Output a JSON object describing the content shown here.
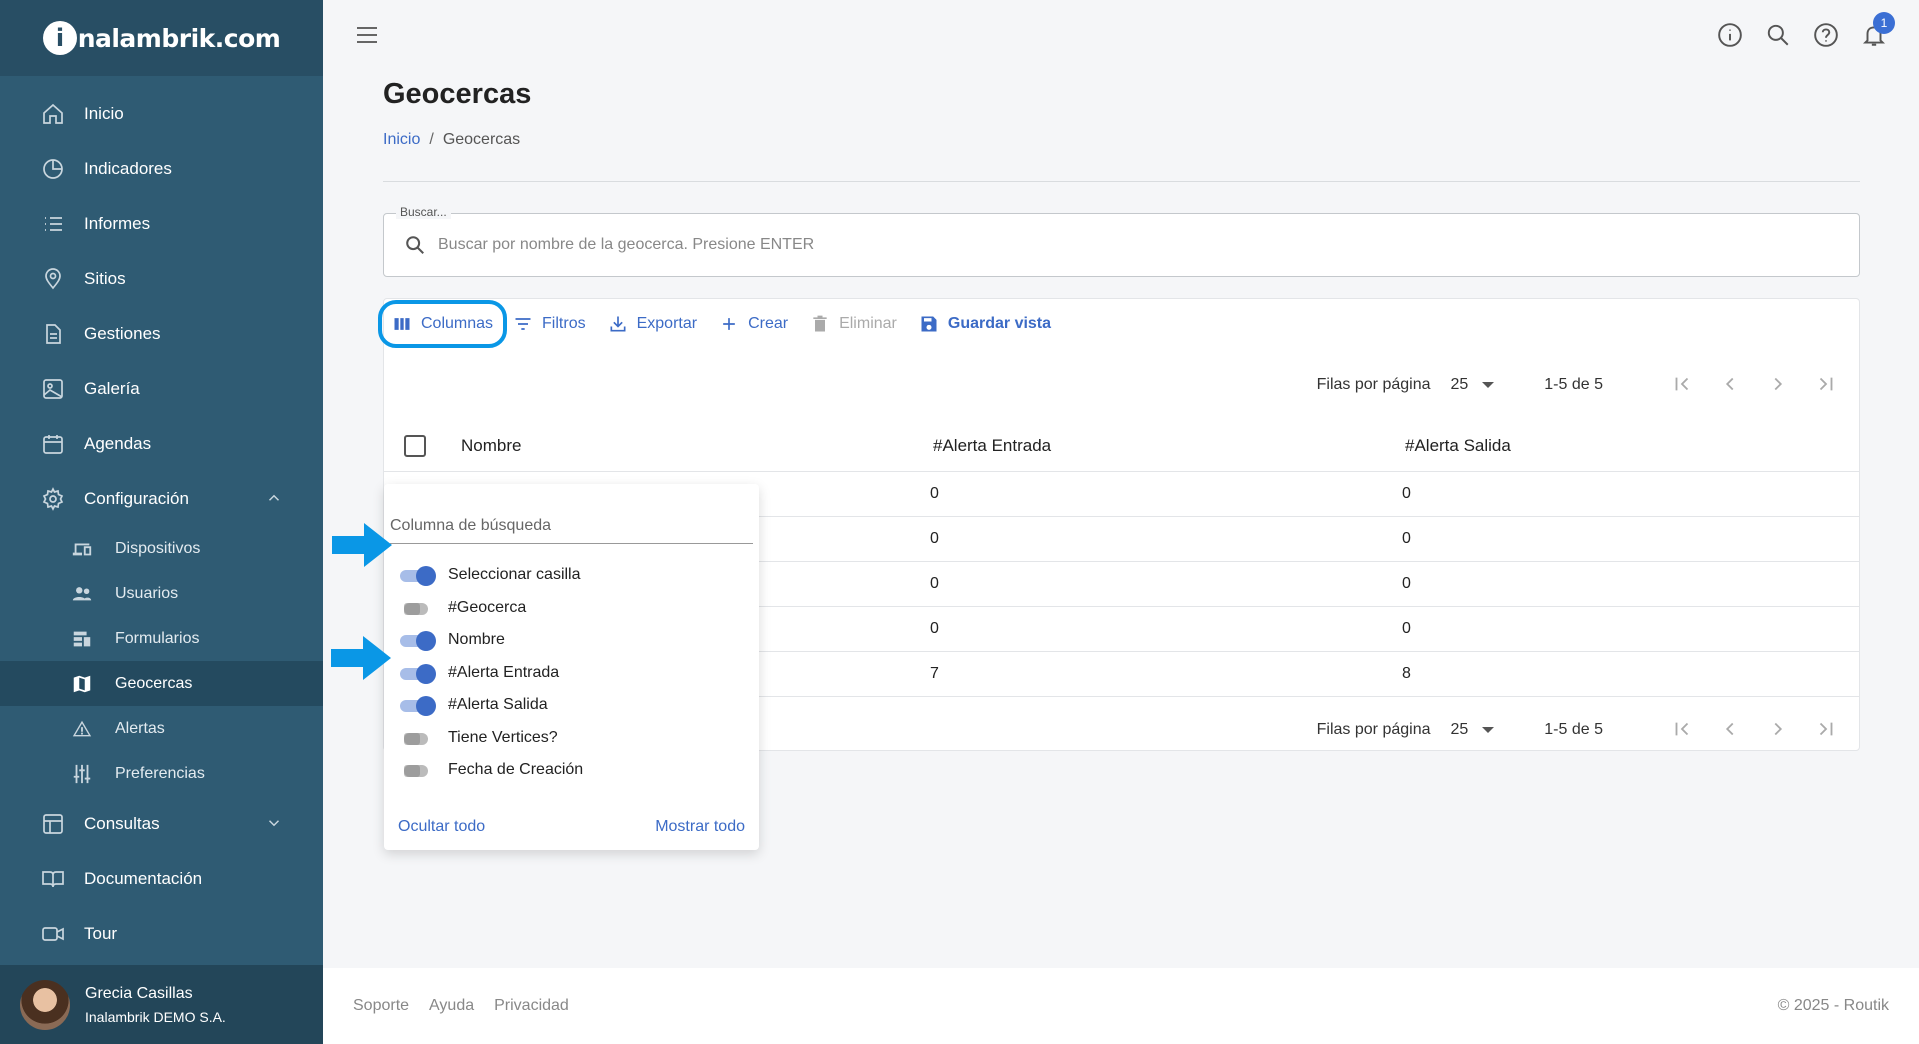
{
  "brand": {
    "logo_text_prefix": "i",
    "logo_text": "nalambrik.com"
  },
  "sidebar": {
    "items": [
      {
        "label": "Inicio",
        "icon": "home-icon"
      },
      {
        "label": "Indicadores",
        "icon": "pie-chart-icon"
      },
      {
        "label": "Informes",
        "icon": "list-icon"
      },
      {
        "label": "Sitios",
        "icon": "location-pin-icon"
      },
      {
        "label": "Gestiones",
        "icon": "document-icon"
      },
      {
        "label": "Galería",
        "icon": "image-icon"
      },
      {
        "label": "Agendas",
        "icon": "calendar-icon"
      },
      {
        "label": "Configuración",
        "icon": "gear-icon"
      }
    ],
    "sub_items": [
      {
        "label": "Dispositivos",
        "icon": "devices-icon"
      },
      {
        "label": "Usuarios",
        "icon": "users-icon"
      },
      {
        "label": "Formularios",
        "icon": "forms-icon"
      },
      {
        "label": "Geocercas",
        "icon": "map-icon",
        "active": true
      },
      {
        "label": "Alertas",
        "icon": "warning-icon"
      },
      {
        "label": "Preferencias",
        "icon": "sliders-icon"
      }
    ],
    "bottom_items": [
      {
        "label": "Consultas",
        "icon": "table-icon"
      },
      {
        "label": "Documentación",
        "icon": "book-icon"
      },
      {
        "label": "Tour",
        "icon": "video-icon"
      }
    ],
    "user": {
      "name": "Grecia Casillas",
      "company": "Inalambrik DEMO S.A."
    }
  },
  "topbar": {
    "notification_count": "1"
  },
  "page": {
    "title": "Geocercas",
    "breadcrumb": {
      "home": "Inicio",
      "sep": "/",
      "current": "Geocercas"
    }
  },
  "search": {
    "legend": "Buscar...",
    "placeholder": "Buscar por nombre de la geocerca. Presione ENTER"
  },
  "toolbar": {
    "columns": "Columnas",
    "filters": "Filtros",
    "export": "Exportar",
    "create": "Crear",
    "delete": "Eliminar",
    "save_view": "Guardar vista"
  },
  "pager": {
    "rows_label": "Filas por página",
    "rows_value": "25",
    "range": "1-5 de 5"
  },
  "table": {
    "headers": {
      "nombre": "Nombre",
      "entrada": "#Alerta Entrada",
      "salida": "#Alerta Salida"
    },
    "rows": [
      {
        "entrada": "0",
        "salida": "0"
      },
      {
        "entrada": "0",
        "salida": "0"
      },
      {
        "entrada": "0",
        "salida": "0"
      },
      {
        "entrada": "0",
        "salida": "0"
      },
      {
        "entrada": "7",
        "salida": "8"
      }
    ]
  },
  "columns_panel": {
    "search_placeholder": "Columna de búsqueda",
    "columns": [
      {
        "label": "Seleccionar casilla",
        "on": true
      },
      {
        "label": "#Geocerca",
        "on": false
      },
      {
        "label": "Nombre",
        "on": true
      },
      {
        "label": "#Alerta Entrada",
        "on": true
      },
      {
        "label": "#Alerta Salida",
        "on": true
      },
      {
        "label": "Tiene Vertices?",
        "on": false
      },
      {
        "label": "Fecha de Creación",
        "on": false
      }
    ],
    "hide_all": "Ocultar todo",
    "show_all": "Mostrar todo"
  },
  "footer": {
    "links": [
      "Soporte",
      "Ayuda",
      "Privacidad"
    ],
    "copyright": "© 2025 - Routik"
  },
  "colors": {
    "sidebar": "#2f5b73",
    "accent": "#3c6bc6",
    "highlight": "#0a97e6"
  }
}
